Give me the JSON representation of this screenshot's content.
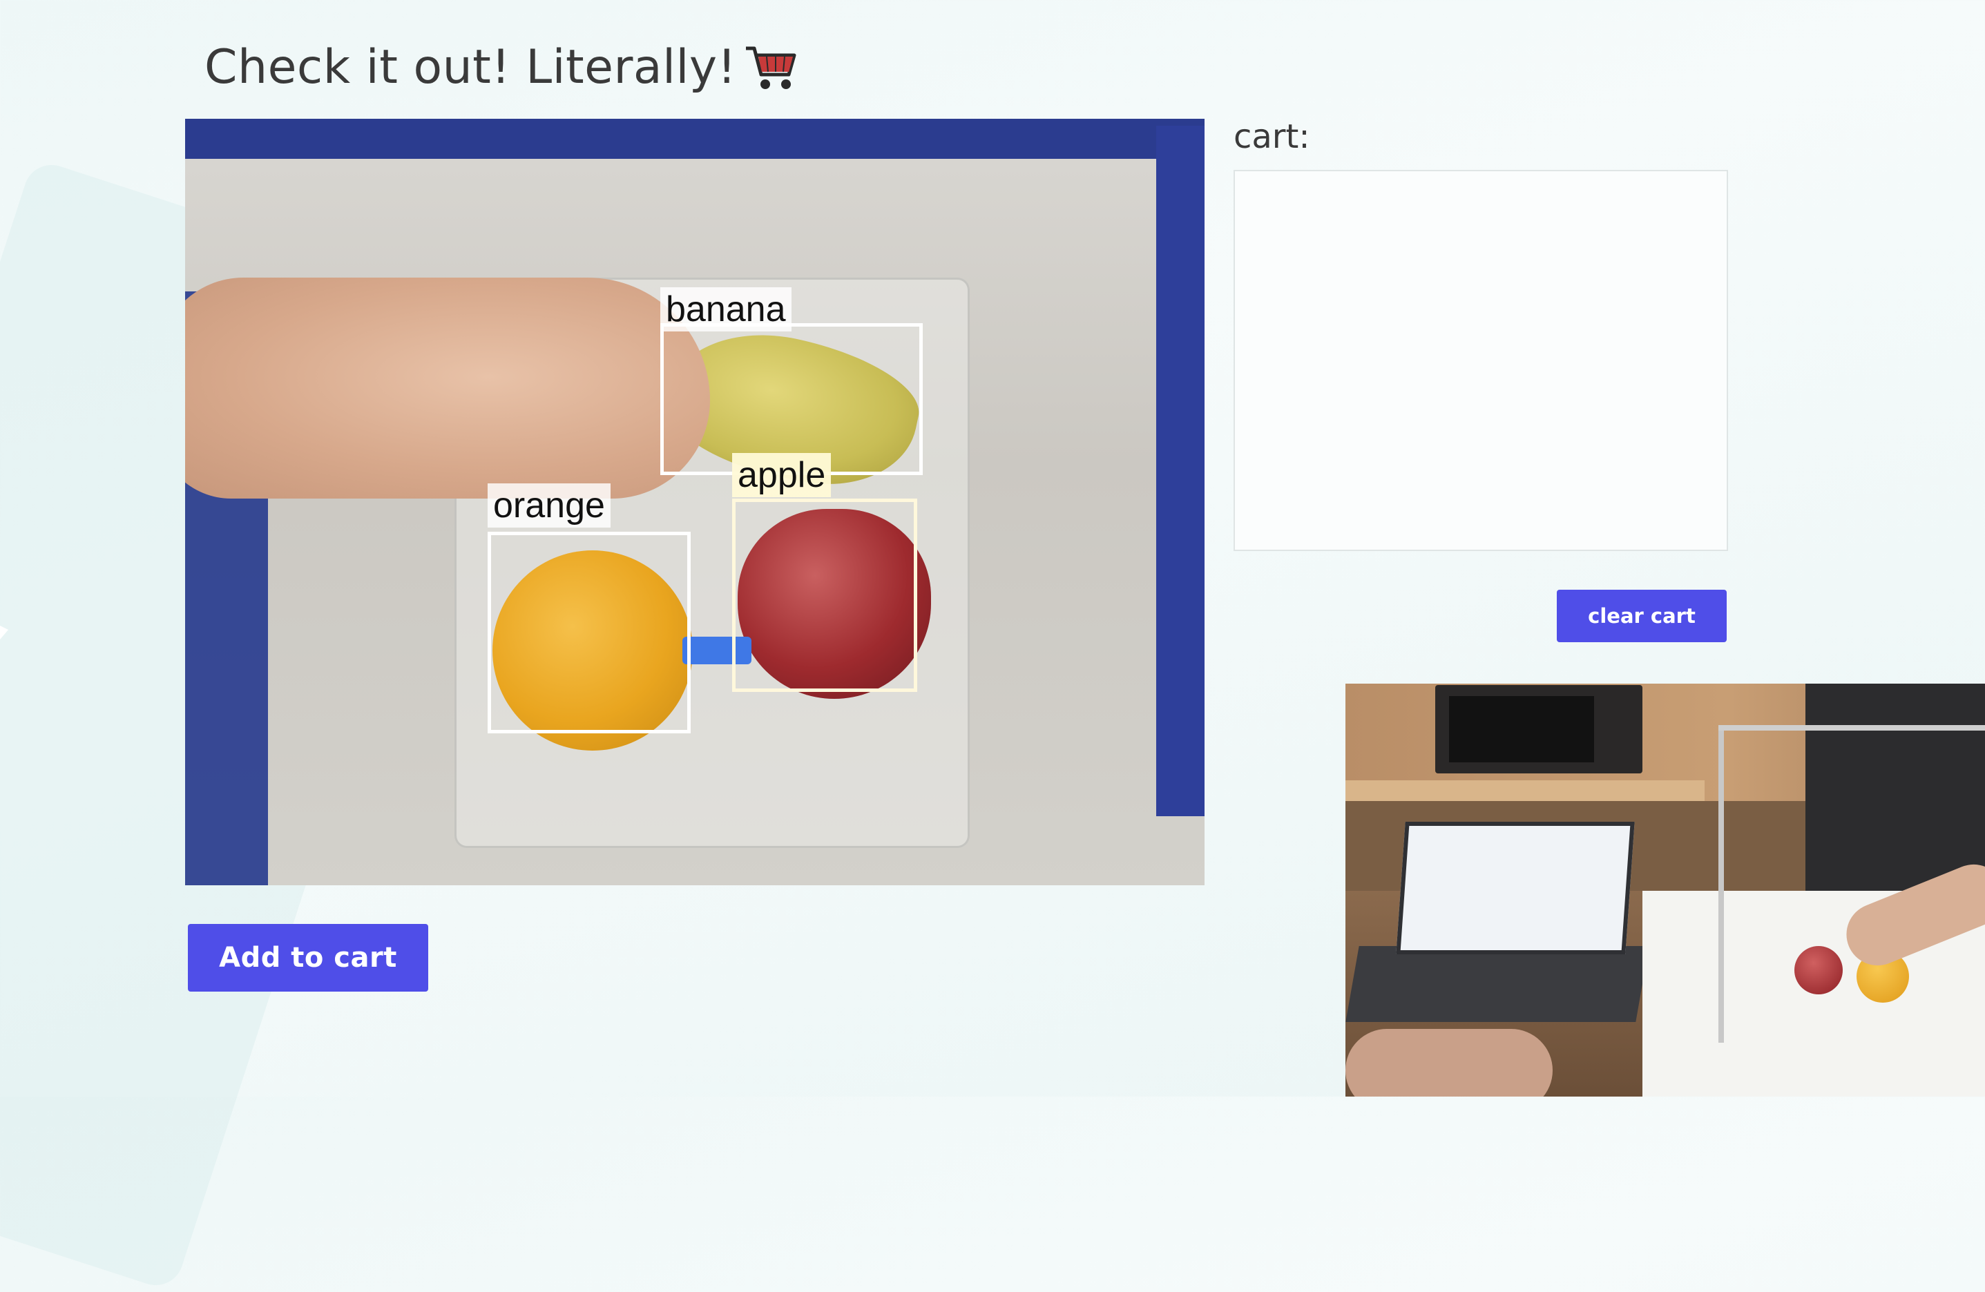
{
  "page": {
    "title": "Check it out! Literally!"
  },
  "camera": {
    "detections": [
      {
        "label": "banana"
      },
      {
        "label": "orange"
      },
      {
        "label": "apple"
      }
    ]
  },
  "cart": {
    "label": "cart:",
    "items": []
  },
  "buttons": {
    "clear_cart": "clear cart",
    "add_to_cart": "Add to cart"
  },
  "colors": {
    "button": "#4f4ee8",
    "title_text": "#3a3a3a",
    "background": "#eef7f7"
  },
  "icons": {
    "title_icon": "shopping-cart-icon"
  }
}
